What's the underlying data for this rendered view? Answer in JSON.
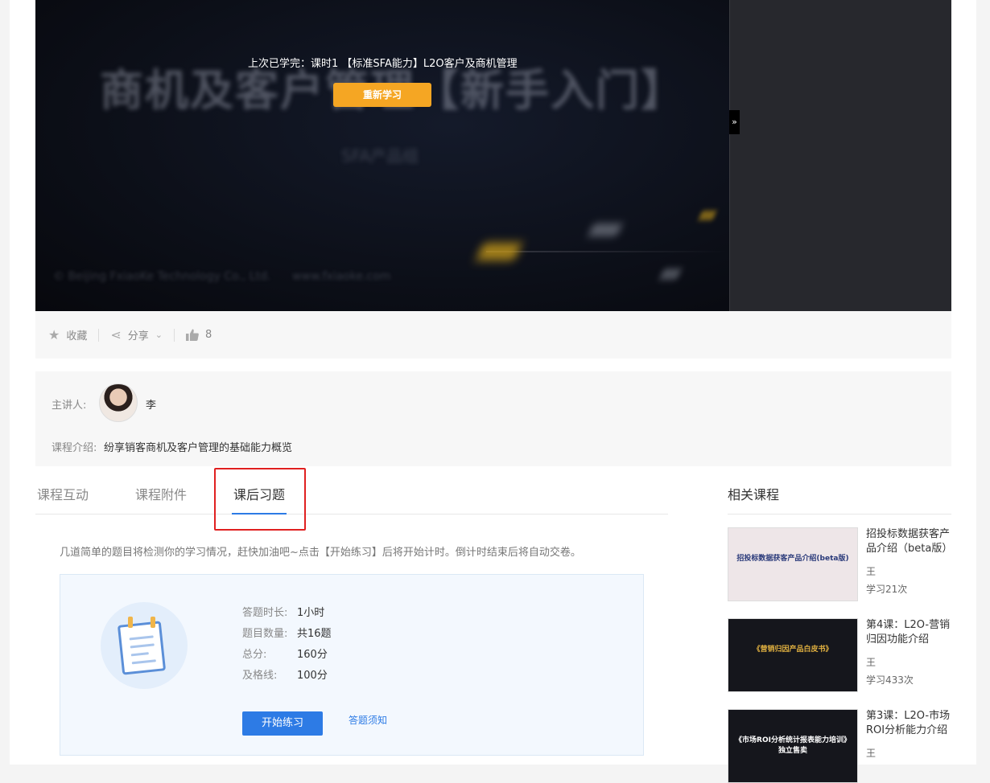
{
  "player": {
    "last_learned": "上次已学完：课时1 【标准SFA能力】L2O客户及商机管理",
    "relearn_button": "重新学习",
    "collapse_icon": "»"
  },
  "actions": {
    "favorite": "收藏",
    "share": "分享",
    "likes": "8"
  },
  "course_info": {
    "presenter_label": "主讲人:",
    "presenter_name": "李",
    "intro_label": "课程介绍:",
    "intro_text": "纷享销客商机及客户管理的基础能力概览"
  },
  "tabs": [
    "课程互动",
    "课程附件",
    "课后习题"
  ],
  "quiz": {
    "description": "几道简单的题目将检测你的学习情况，赶快加油吧~点击【开始练习】后将开始计时。倒计时结束后将自动交卷。",
    "rows": [
      {
        "k": "答题时长:",
        "v": "1小时"
      },
      {
        "k": "题目数量:",
        "v": "共16题"
      },
      {
        "k": "总分:",
        "v": "160分"
      },
      {
        "k": "及格线:",
        "v": "100分"
      }
    ],
    "start_button": "开始练习",
    "notice_link": "答题须知"
  },
  "related": {
    "title": "相关课程",
    "items": [
      {
        "title": "招投标数据获客产品介绍（beta版）",
        "author": "王",
        "count": "学习21次",
        "thumb_text": "招投标数据获客产品介绍(beta版)"
      },
      {
        "title": "第4课：L2O-营销归因功能介绍",
        "author": "王",
        "count": "学习433次",
        "thumb_text": "《营销归因产品白皮书》"
      },
      {
        "title": "第3课：L2O-市场ROI分析能力介绍",
        "author": "王",
        "count": "",
        "thumb_text": "《市场ROI分析统计报表能力培训》\n独立售卖"
      }
    ]
  }
}
